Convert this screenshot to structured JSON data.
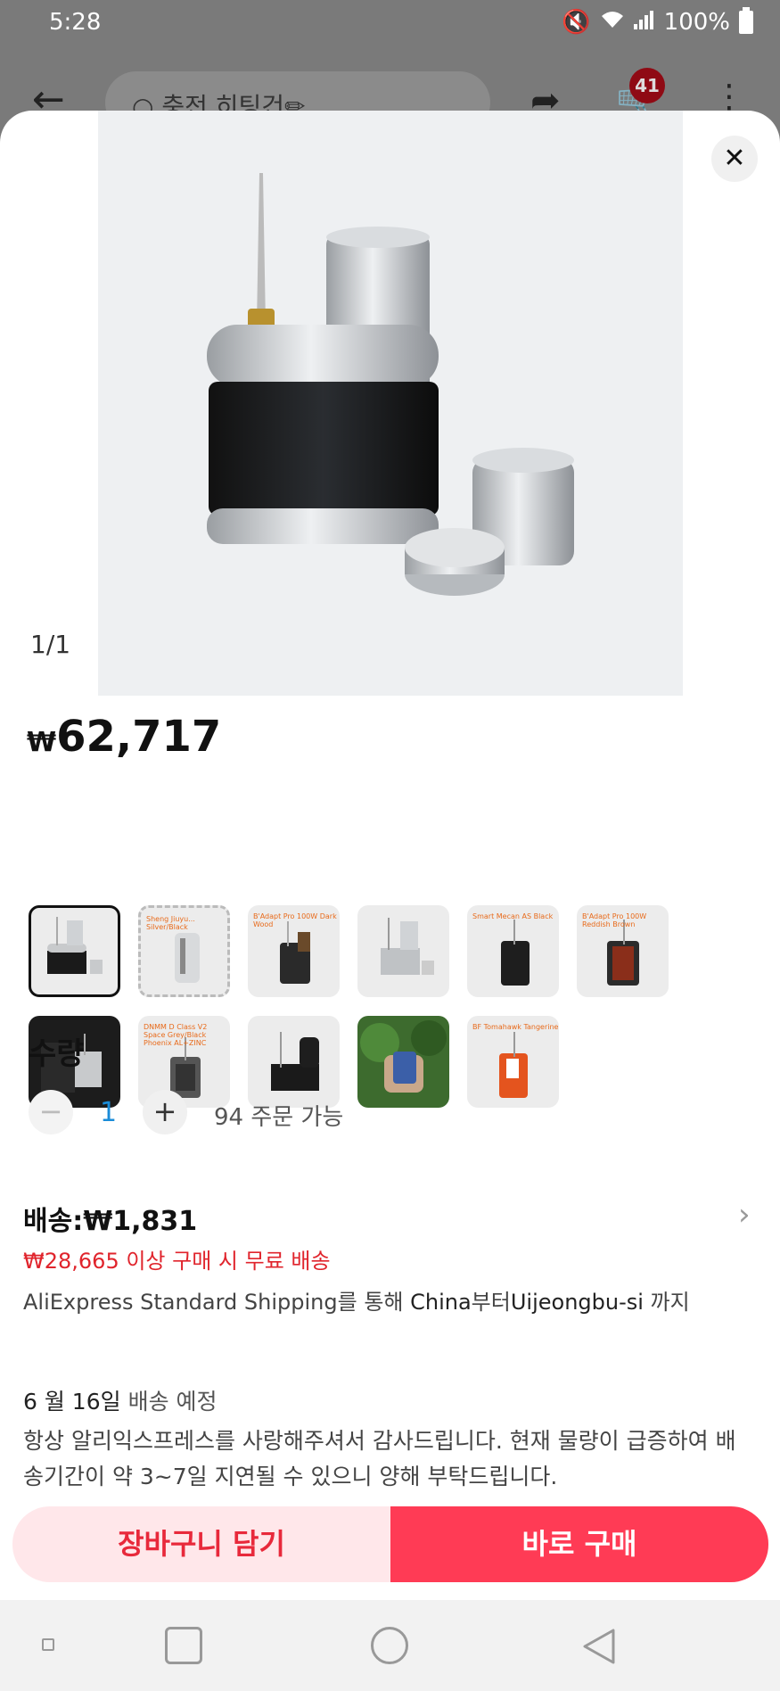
{
  "status_bar": {
    "time": "5:28",
    "battery": "100%"
  },
  "background_header": {
    "search_placeholder": "충전 히팅건✏",
    "cart_count": "41"
  },
  "image_viewer": {
    "counter": "1/1"
  },
  "price": {
    "currency": "₩",
    "amount": "62,717"
  },
  "variants": [
    {
      "label": ""
    },
    {
      "label": "Sheng Jiuyu... Silver/Black"
    },
    {
      "label": "B'Adapt Pro 100W Dark Wood"
    },
    {
      "label": ""
    },
    {
      "label": "Smart Mecan AS Black"
    },
    {
      "label": "B'Adapt Pro 100W Reddish Brown"
    },
    {
      "label": ""
    },
    {
      "label": "DNMM D Class V2 Space Grey/Black Phoenix AL+ZINC"
    },
    {
      "label": ""
    },
    {
      "label": ""
    },
    {
      "label": "BF Tomahawk Tangerine"
    }
  ],
  "quantity": {
    "title": "수량",
    "minus": "−",
    "value": "1",
    "plus": "+",
    "available": "94 주문 가능"
  },
  "shipping": {
    "title": "배송:₩1,831",
    "free_notice": "₩28,665 이상 구매 시 무료 배송",
    "method": "AliExpress Standard Shipping",
    "route_part1": "를 통해 ",
    "origin": "China",
    "route_part2": "부터",
    "destination": "Uijeongbu-si",
    "route_part3": " 까지",
    "delivery_date": "6 월 16일",
    "delivery_label": " 배송 예정",
    "notice": "항상 알리익스프레스를 사랑해주셔서 감사드립니다. 현재 물량이 급증하여 배송기간이 약 3~7일 지연될 수 있으니 양해 부탁드립니다."
  },
  "actions": {
    "add_to_cart": "장바구니 담기",
    "buy_now": "바로 구매"
  },
  "colors": {
    "accent": "#ff3b55",
    "accent_light": "#ffe7ea",
    "price_red": "#e0242c",
    "qty_blue": "#1a8cd8"
  }
}
